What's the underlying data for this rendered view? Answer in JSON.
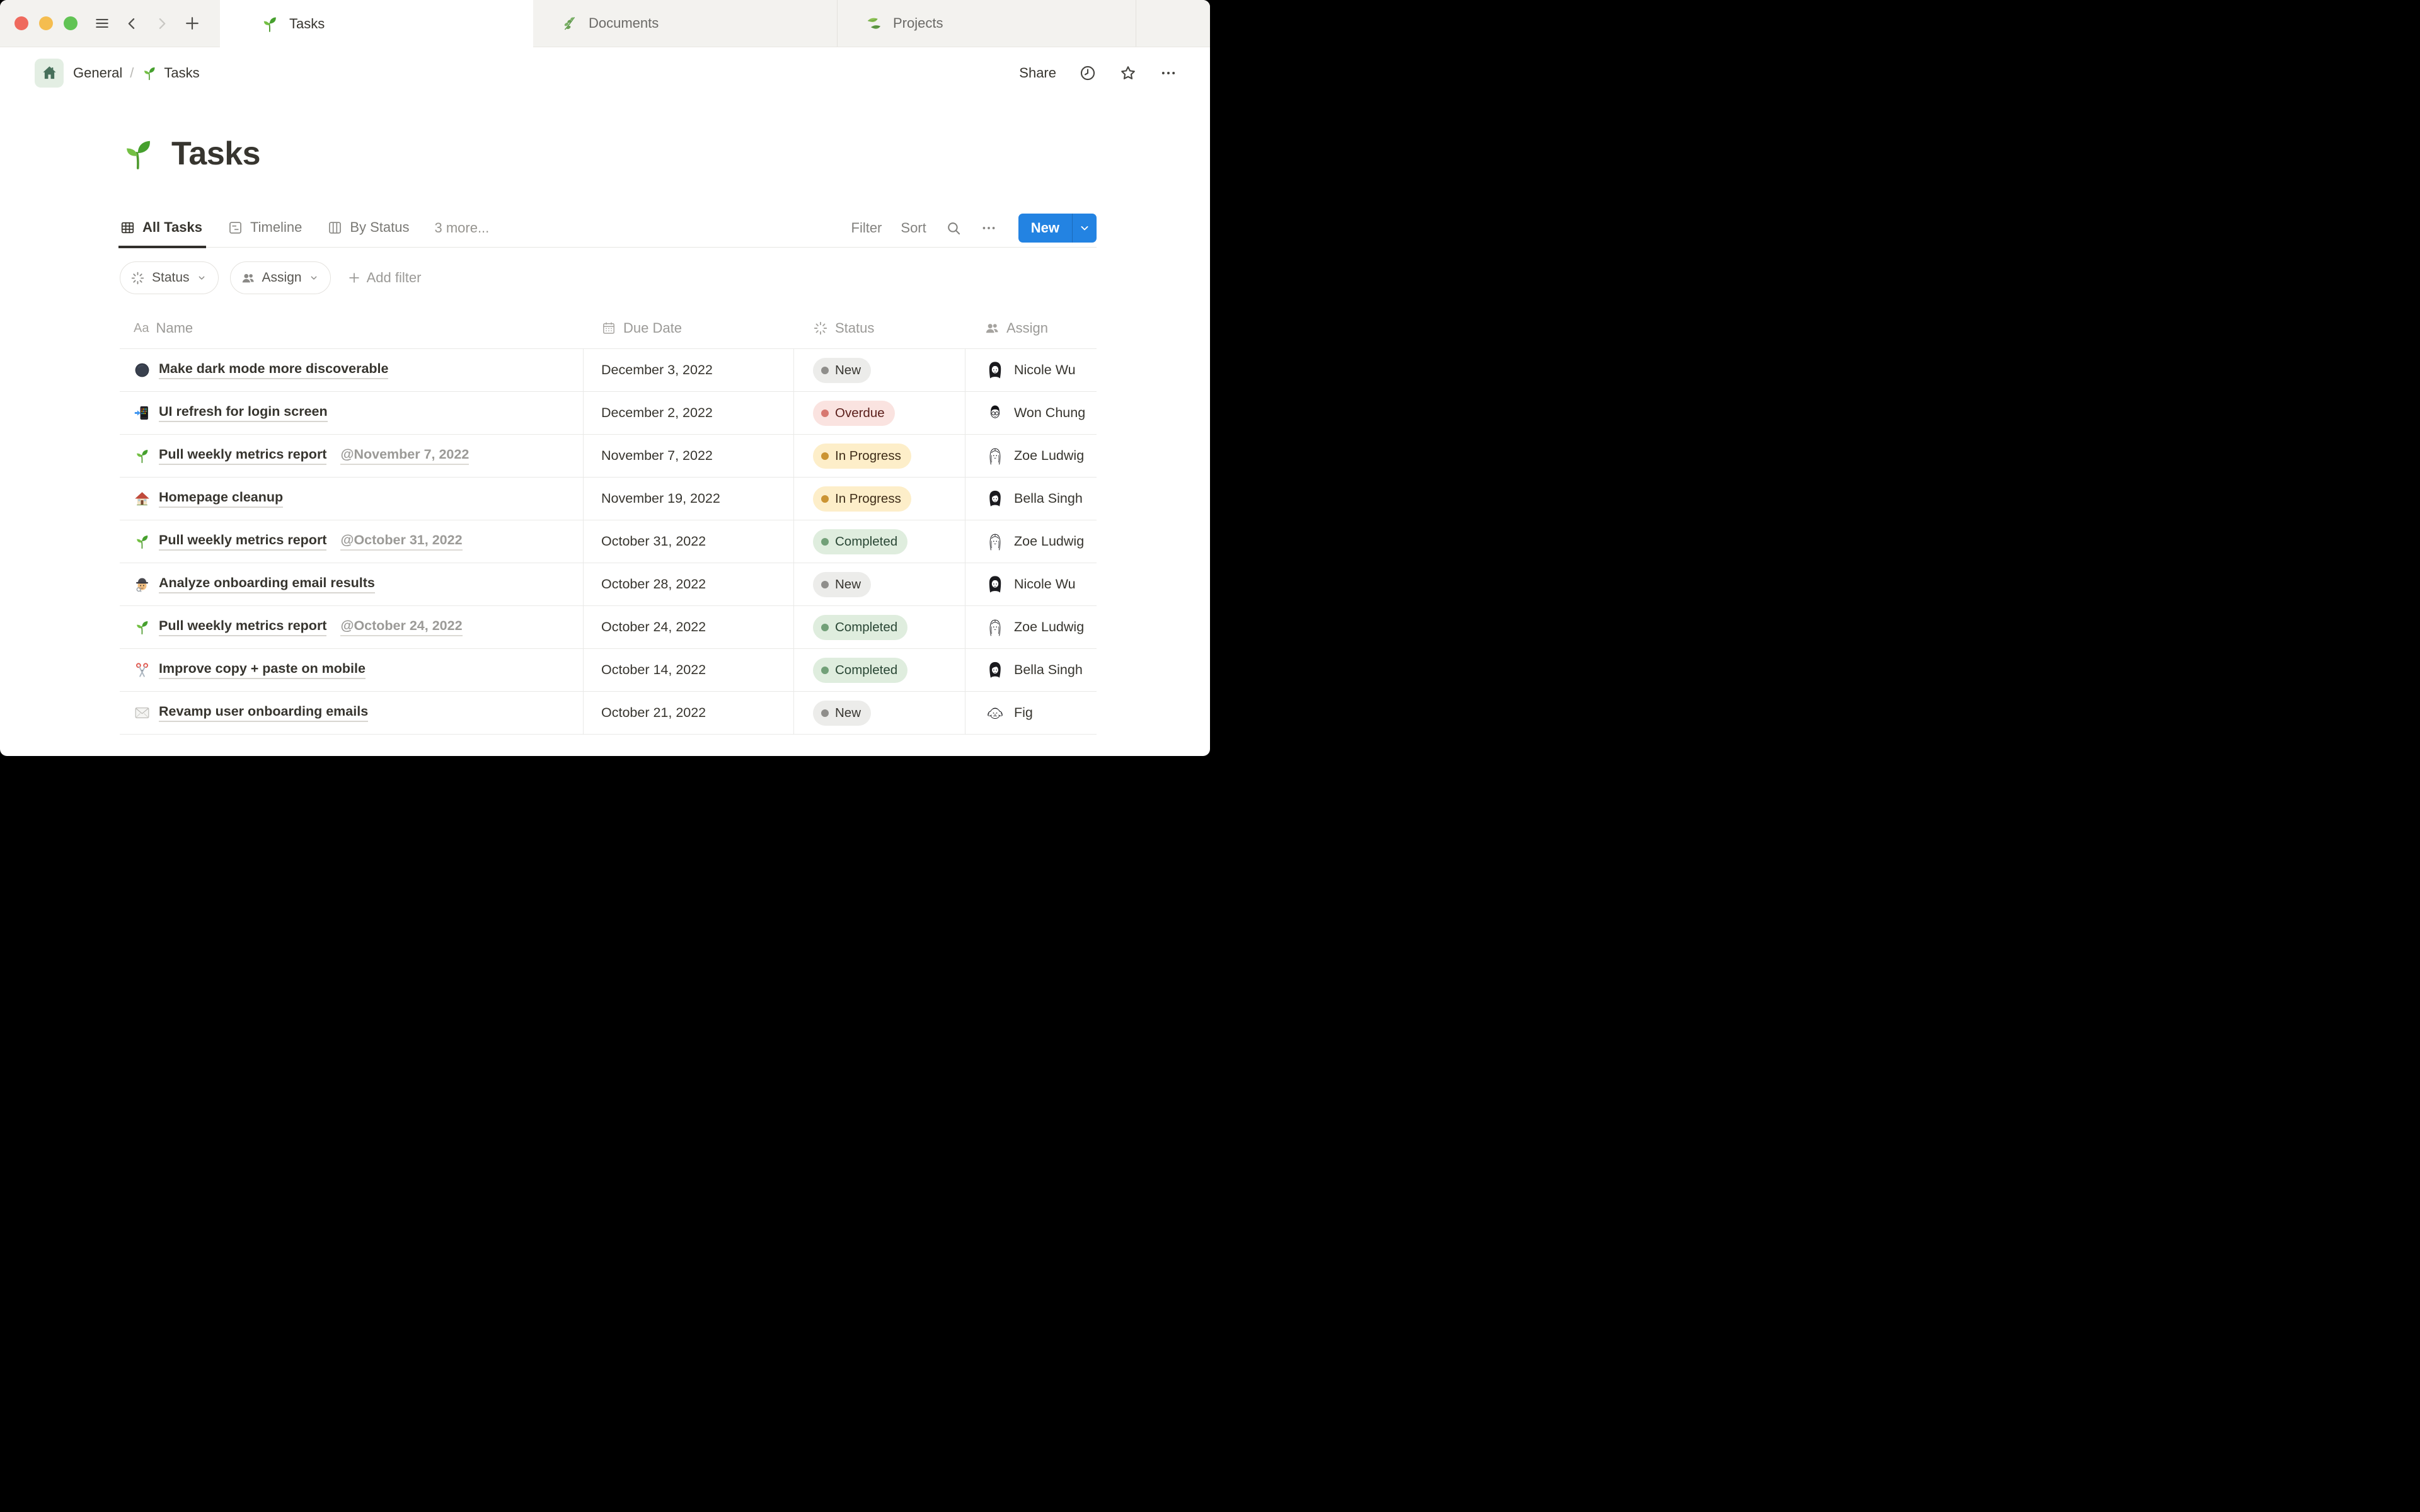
{
  "chrome": {
    "tabs": [
      {
        "label": "Tasks",
        "icon": "seedling",
        "active": true
      },
      {
        "label": "Documents",
        "icon": "herb",
        "active": false
      },
      {
        "label": "Projects",
        "icon": "leaves",
        "active": false
      }
    ]
  },
  "breadcrumb": {
    "workspace": "General",
    "separator": "/",
    "page": "Tasks",
    "page_icon": "seedling"
  },
  "header_actions": {
    "share": "Share"
  },
  "page": {
    "icon": "seedling",
    "title": "Tasks"
  },
  "views": {
    "tabs": [
      {
        "label": "All Tasks",
        "icon": "table",
        "active": true
      },
      {
        "label": "Timeline",
        "icon": "timeline",
        "active": false
      },
      {
        "label": "By Status",
        "icon": "board",
        "active": false
      }
    ],
    "more_label": "3 more...",
    "filter_label": "Filter",
    "sort_label": "Sort",
    "new_label": "New"
  },
  "filter_bar": {
    "chips": [
      {
        "label": "Status",
        "icon": "status"
      },
      {
        "label": "Assign",
        "icon": "people"
      }
    ],
    "add_label": "Add filter"
  },
  "table": {
    "columns": [
      {
        "label": "Name",
        "icon": "text"
      },
      {
        "label": "Due Date",
        "icon": "calendar"
      },
      {
        "label": "Status",
        "icon": "status"
      },
      {
        "label": "Assign",
        "icon": "people"
      }
    ],
    "rows": [
      {
        "icon": "new-moon",
        "name": "Make dark mode more discoverable",
        "mention": "",
        "due": "December 3, 2022",
        "status": "New",
        "assignee": "Nicole Wu",
        "avatar": "nicole"
      },
      {
        "icon": "phone",
        "name": "UI refresh for login screen",
        "mention": "",
        "due": "December 2, 2022",
        "status": "Overdue",
        "assignee": "Won Chung",
        "avatar": "won"
      },
      {
        "icon": "seedling",
        "name": "Pull weekly metrics report",
        "mention": "@November 7, 2022",
        "due": "November 7, 2022",
        "status": "In Progress",
        "assignee": "Zoe Ludwig",
        "avatar": "zoe"
      },
      {
        "icon": "house",
        "name": "Homepage cleanup",
        "mention": "",
        "due": "November 19, 2022",
        "status": "In Progress",
        "assignee": "Bella Singh",
        "avatar": "bella"
      },
      {
        "icon": "seedling",
        "name": "Pull weekly metrics report",
        "mention": "@October 31, 2022",
        "due": "October 31, 2022",
        "status": "Completed",
        "assignee": "Zoe Ludwig",
        "avatar": "zoe"
      },
      {
        "icon": "detective",
        "name": "Analyze onboarding email results",
        "mention": "",
        "due": "October 28, 2022",
        "status": "New",
        "assignee": "Nicole Wu",
        "avatar": "nicole"
      },
      {
        "icon": "seedling",
        "name": "Pull weekly metrics report",
        "mention": "@October 24, 2022",
        "due": "October 24, 2022",
        "status": "Completed",
        "assignee": "Zoe Ludwig",
        "avatar": "zoe"
      },
      {
        "icon": "scissors",
        "name": "Improve copy + paste on mobile",
        "mention": "",
        "due": "October 14, 2022",
        "status": "Completed",
        "assignee": "Bella Singh",
        "avatar": "bella"
      },
      {
        "icon": "envelope",
        "name": "Revamp user onboarding emails",
        "mention": "",
        "due": "October 21, 2022",
        "status": "New",
        "assignee": "Fig",
        "avatar": "fig"
      }
    ]
  },
  "status_colors": {
    "New": {
      "bg": "#ECECEA",
      "dot": "#8F8E8B",
      "text": "#373530"
    },
    "Overdue": {
      "bg": "#FAE3E0",
      "dot": "#D77870",
      "text": "#5A1E1A"
    },
    "In Progress": {
      "bg": "#FDEEC9",
      "dot": "#CB9433",
      "text": "#3F2D18"
    },
    "Completed": {
      "bg": "#DFEDDE",
      "dot": "#72A078",
      "text": "#294634"
    }
  },
  "accent": {
    "primary": "#2383E2"
  }
}
